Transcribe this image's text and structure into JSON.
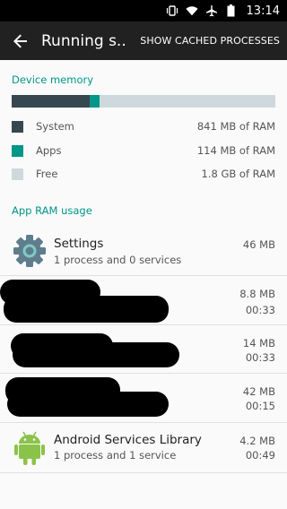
{
  "status_bar": {
    "time": "13:14"
  },
  "app_bar": {
    "title": "Running s...",
    "action": "SHOW CACHED PROCESSES"
  },
  "device_memory": {
    "title": "Device memory",
    "bar": {
      "system_fraction": 0.295,
      "apps_fraction": 0.04,
      "colors": {
        "system": "#37474f",
        "apps": "#009688",
        "free": "#cfd8dc"
      }
    },
    "legend": [
      {
        "label": "System",
        "value": "841 MB of RAM"
      },
      {
        "label": "Apps",
        "value": "114 MB of RAM"
      },
      {
        "label": "Free",
        "value": "1.8 GB of RAM"
      }
    ]
  },
  "app_ram": {
    "title": "App RAM usage",
    "apps": [
      {
        "name": "Settings",
        "sub": "1 process and 0 services",
        "size": "46 MB",
        "time": "",
        "icon": "settings-gear-icon"
      },
      {
        "name": "",
        "sub": "",
        "size": "8.8 MB",
        "time": "00:33",
        "icon": ""
      },
      {
        "name": "",
        "sub": "",
        "size": "14 MB",
        "time": "00:33",
        "icon": ""
      },
      {
        "name": "",
        "sub": "",
        "size": "42 MB",
        "time": "00:15",
        "icon": ""
      },
      {
        "name": "Android Services Library",
        "sub": "1 process and 1 service",
        "size": "4.2 MB",
        "time": "00:49",
        "icon": "android-robot-icon"
      }
    ]
  }
}
